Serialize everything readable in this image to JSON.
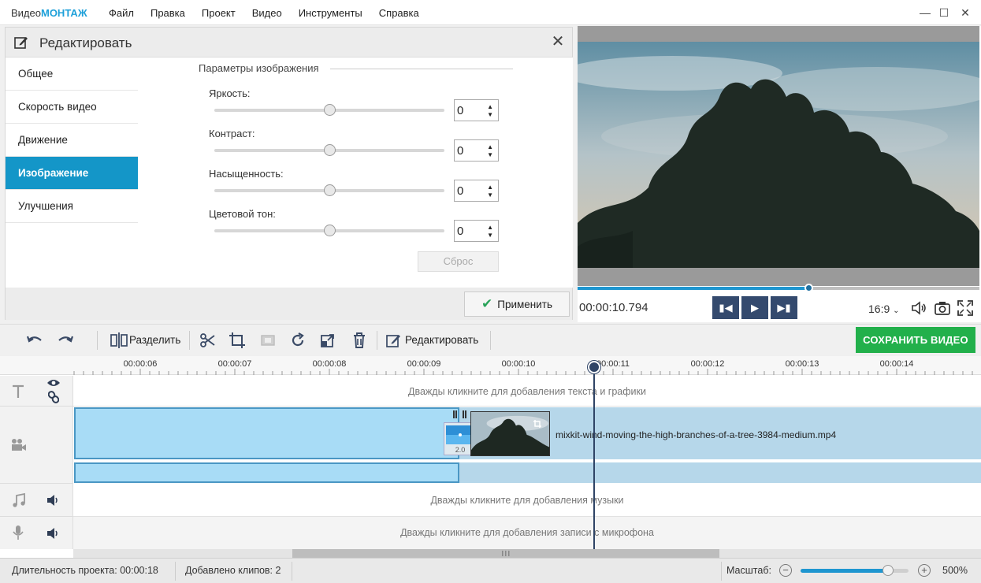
{
  "app": {
    "logo_prefix": "Видео",
    "logo_brand": "МОНТАЖ",
    "accent_color": "#1ea0d9"
  },
  "menu": [
    "Файл",
    "Правка",
    "Проект",
    "Видео",
    "Инструменты",
    "Справка"
  ],
  "edit_panel": {
    "title": "Редактировать",
    "tabs": [
      {
        "label": "Общее"
      },
      {
        "label": "Скорость видео"
      },
      {
        "label": "Движение"
      },
      {
        "label": "Изображение",
        "active": true
      },
      {
        "label": "Улучшения"
      }
    ],
    "group_title": "Параметры изображения",
    "params": [
      {
        "label": "Яркость:",
        "value": "0",
        "level": 0.5
      },
      {
        "label": "Контраст:",
        "value": "0",
        "level": 0.5
      },
      {
        "label": "Насыщенность:",
        "value": "0",
        "level": 0.5
      },
      {
        "label": "Цветовой тон:",
        "value": "0",
        "level": 0.5
      }
    ],
    "reset_label": "Сброс",
    "apply_label": "Применить"
  },
  "preview": {
    "timecode": "00:00:10.794",
    "progress": 0.577,
    "aspect_ratio": "16:9"
  },
  "toolbar": {
    "split_label": "Разделить",
    "edit_label": "Редактировать",
    "save_label": "СОХРАНИТЬ ВИДЕО",
    "save_color": "#22b04b"
  },
  "timeline": {
    "ticks": [
      "00:00:06",
      "00:00:07",
      "00:00:08",
      "00:00:09",
      "00:00:10",
      "00:00:11",
      "00:00:12",
      "00:00:13",
      "00:00:14"
    ],
    "text_hint": "Дважды кликните для добавления текста и графики",
    "music_hint": "Дважды кликните для добавления музыки",
    "mic_hint": "Дважды кликните для добавления записи с микрофона",
    "clip_name": "mixkit-wind-moving-the-high-branches-of-a-tree-3984-medium.mp4",
    "transition_duration": "2.0"
  },
  "status": {
    "duration_label": "Длительность проекта:",
    "duration_value": "00:00:18",
    "clips_label": "Добавлено клипов:",
    "clips_value": "2",
    "zoom_label": "Масштаб:",
    "zoom_value": "500%",
    "zoom_level": 0.81
  }
}
